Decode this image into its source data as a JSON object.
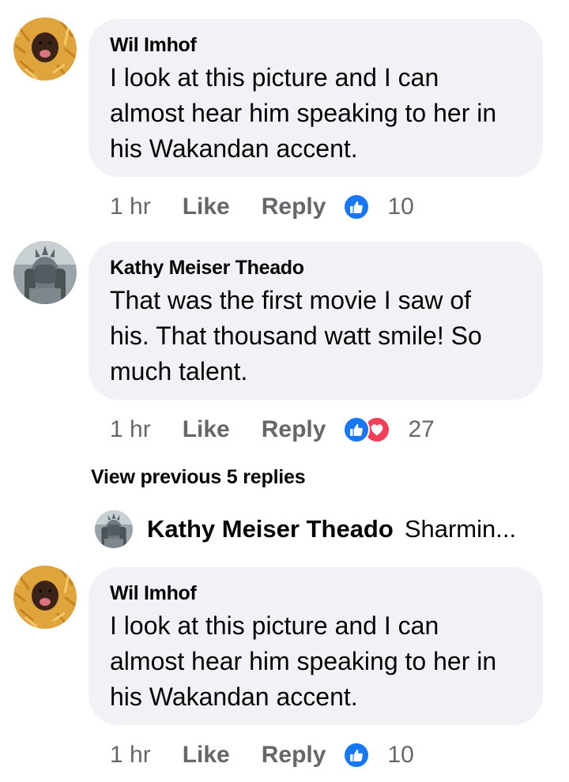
{
  "comments": [
    {
      "author": "Wil Imhof",
      "text": "I look at this picture and I can\nalmost hear him speaking to her in\nhis Wakandan accent.",
      "time": "1 hr",
      "like_label": "Like",
      "reply_label": "Reply",
      "reaction_count": "10",
      "reactions": [
        "like-icon"
      ]
    },
    {
      "author": "Kathy Meiser Theado",
      "text": "That was the first movie I saw of\nhis.  That thousand watt smile!  So\nmuch talent.",
      "time": "1 hr",
      "like_label": "Like",
      "reply_label": "Reply",
      "reaction_count": "27",
      "reactions": [
        "like-icon",
        "love-icon"
      ]
    },
    {
      "author": "Wil Imhof",
      "text": "I look at this picture and I can\nalmost hear him speaking to her in\nhis Wakandan accent.",
      "time": "1 hr",
      "like_label": "Like",
      "reply_label": "Reply",
      "reaction_count": "10",
      "reactions": [
        "like-icon"
      ]
    }
  ],
  "view_previous": "View previous 5 replies",
  "collapsed_reply": {
    "author": "Kathy Meiser Theado",
    "snippet": "Sharmin..."
  },
  "colors": {
    "bubble": "#f0f2f5",
    "meta_text": "#65676b",
    "like_blue": "#1877f2",
    "love_red": "#f33e58"
  }
}
